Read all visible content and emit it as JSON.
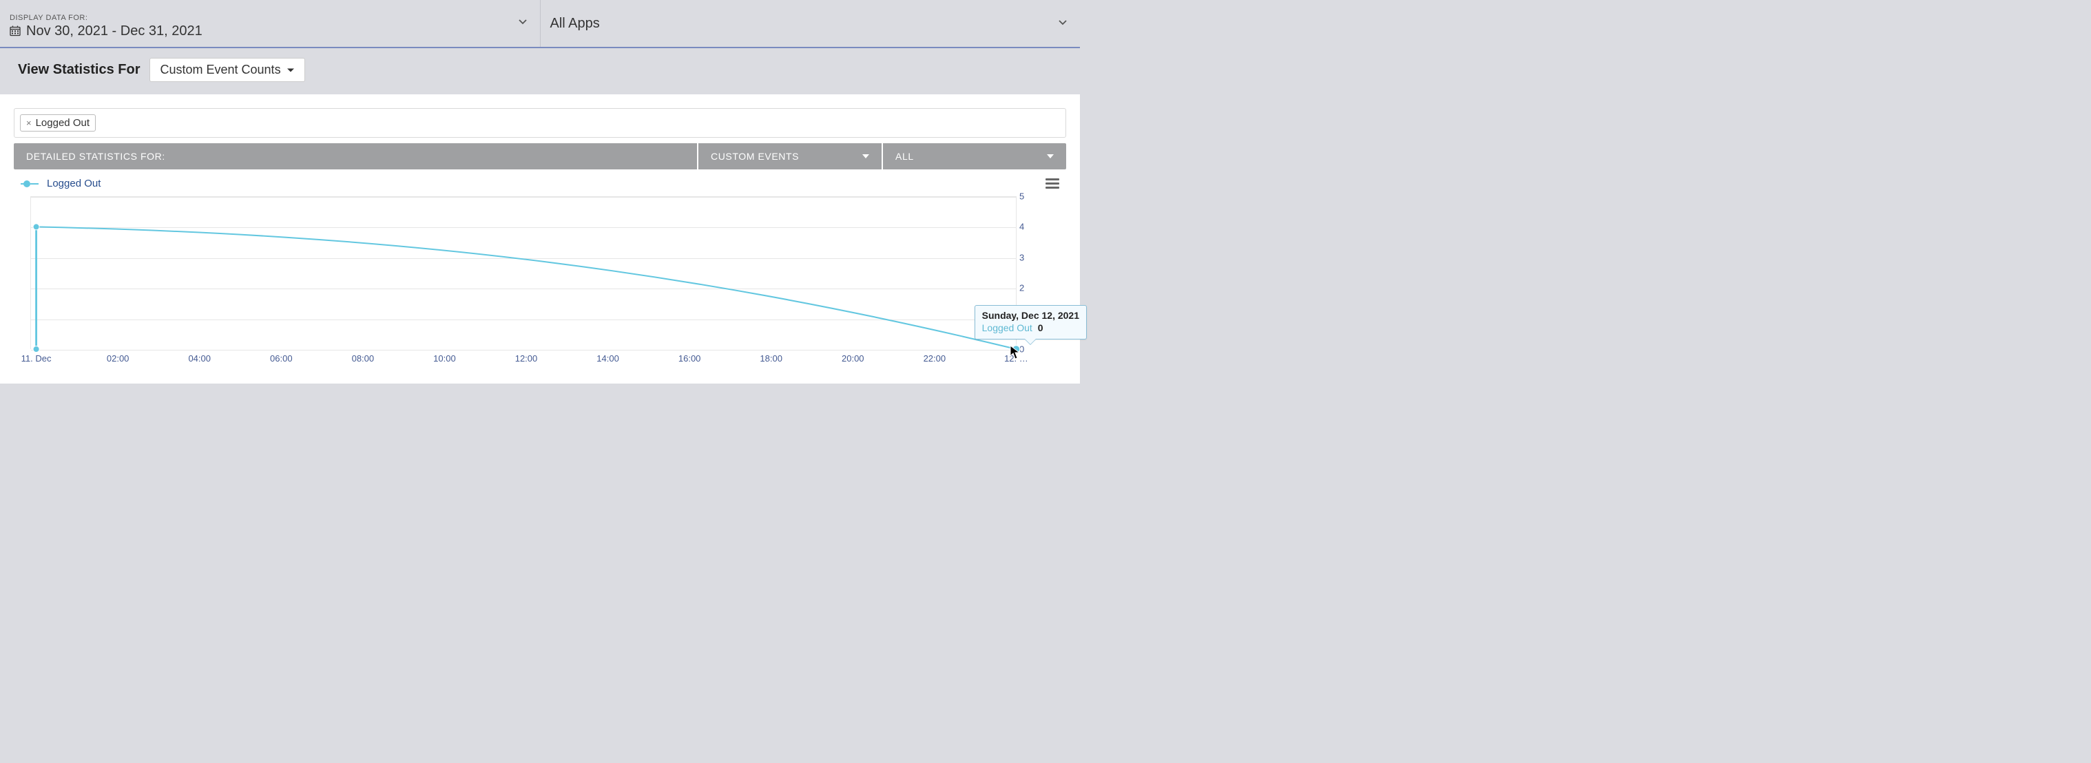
{
  "header": {
    "display_label": "DISPLAY DATA FOR:",
    "date_range": "Nov 30, 2021 - Dec 31, 2021",
    "app_selector": "All Apps"
  },
  "subheader": {
    "label": "View Statistics For",
    "dropdown": "Custom Event Counts"
  },
  "filter": {
    "chips": [
      "Logged Out"
    ]
  },
  "stats_bar": {
    "label": "DETAILED STATISTICS FOR:",
    "dd1": "CUSTOM EVENTS",
    "dd2": "ALL"
  },
  "legend": {
    "series_name": "Logged Out"
  },
  "tooltip": {
    "title": "Sunday, Dec 12, 2021",
    "series": "Logged Out",
    "value": "0"
  },
  "chart_data": {
    "type": "line",
    "title": "",
    "xlabel": "",
    "ylabel": "",
    "ylim": [
      0,
      5
    ],
    "y_ticks": [
      0,
      1,
      2,
      3,
      4,
      5
    ],
    "x_categories": [
      "11. Dec",
      "02:00",
      "04:00",
      "06:00",
      "08:00",
      "10:00",
      "12:00",
      "14:00",
      "16:00",
      "18:00",
      "20:00",
      "22:00",
      "12. …"
    ],
    "series": [
      {
        "name": "Logged Out",
        "color": "#63c7e0",
        "points": [
          {
            "x": "11. Dec 00:00",
            "y_start": 0,
            "y": 4
          },
          {
            "x": "12. Dec 00:00",
            "y": 0
          }
        ]
      }
    ]
  }
}
